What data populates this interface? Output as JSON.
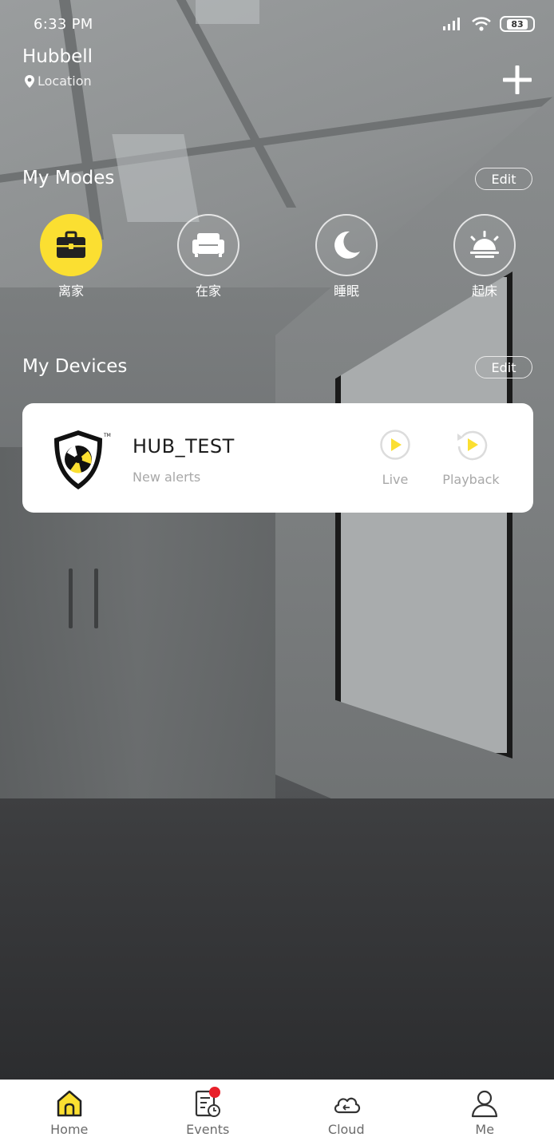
{
  "status_bar": {
    "time": "6:33 PM",
    "battery": "83"
  },
  "header": {
    "title": "Hubbell",
    "location": "Location"
  },
  "modes": {
    "title": "My Modes",
    "edit_label": "Edit",
    "items": [
      {
        "label": "离家",
        "icon": "briefcase-icon",
        "active": true
      },
      {
        "label": "在家",
        "icon": "sofa-icon",
        "active": false
      },
      {
        "label": "睡眠",
        "icon": "moon-icon",
        "active": false
      },
      {
        "label": "起床",
        "icon": "sunrise-icon",
        "active": false
      }
    ]
  },
  "devices": {
    "title": "My Devices",
    "edit_label": "Edit",
    "items": [
      {
        "name": "HUB_TEST",
        "status": "New alerts",
        "live_label": "Live",
        "playback_label": "Playback"
      }
    ]
  },
  "tabbar": {
    "tabs": [
      {
        "label": "Home",
        "icon": "home-icon",
        "active": true
      },
      {
        "label": "Events",
        "icon": "events-icon",
        "badge": true
      },
      {
        "label": "Cloud",
        "icon": "cloud-icon"
      },
      {
        "label": "Me",
        "icon": "person-icon"
      }
    ]
  },
  "colors": {
    "accent": "#fbdf31",
    "badge": "#e8202a",
    "card": "#ffffff"
  }
}
